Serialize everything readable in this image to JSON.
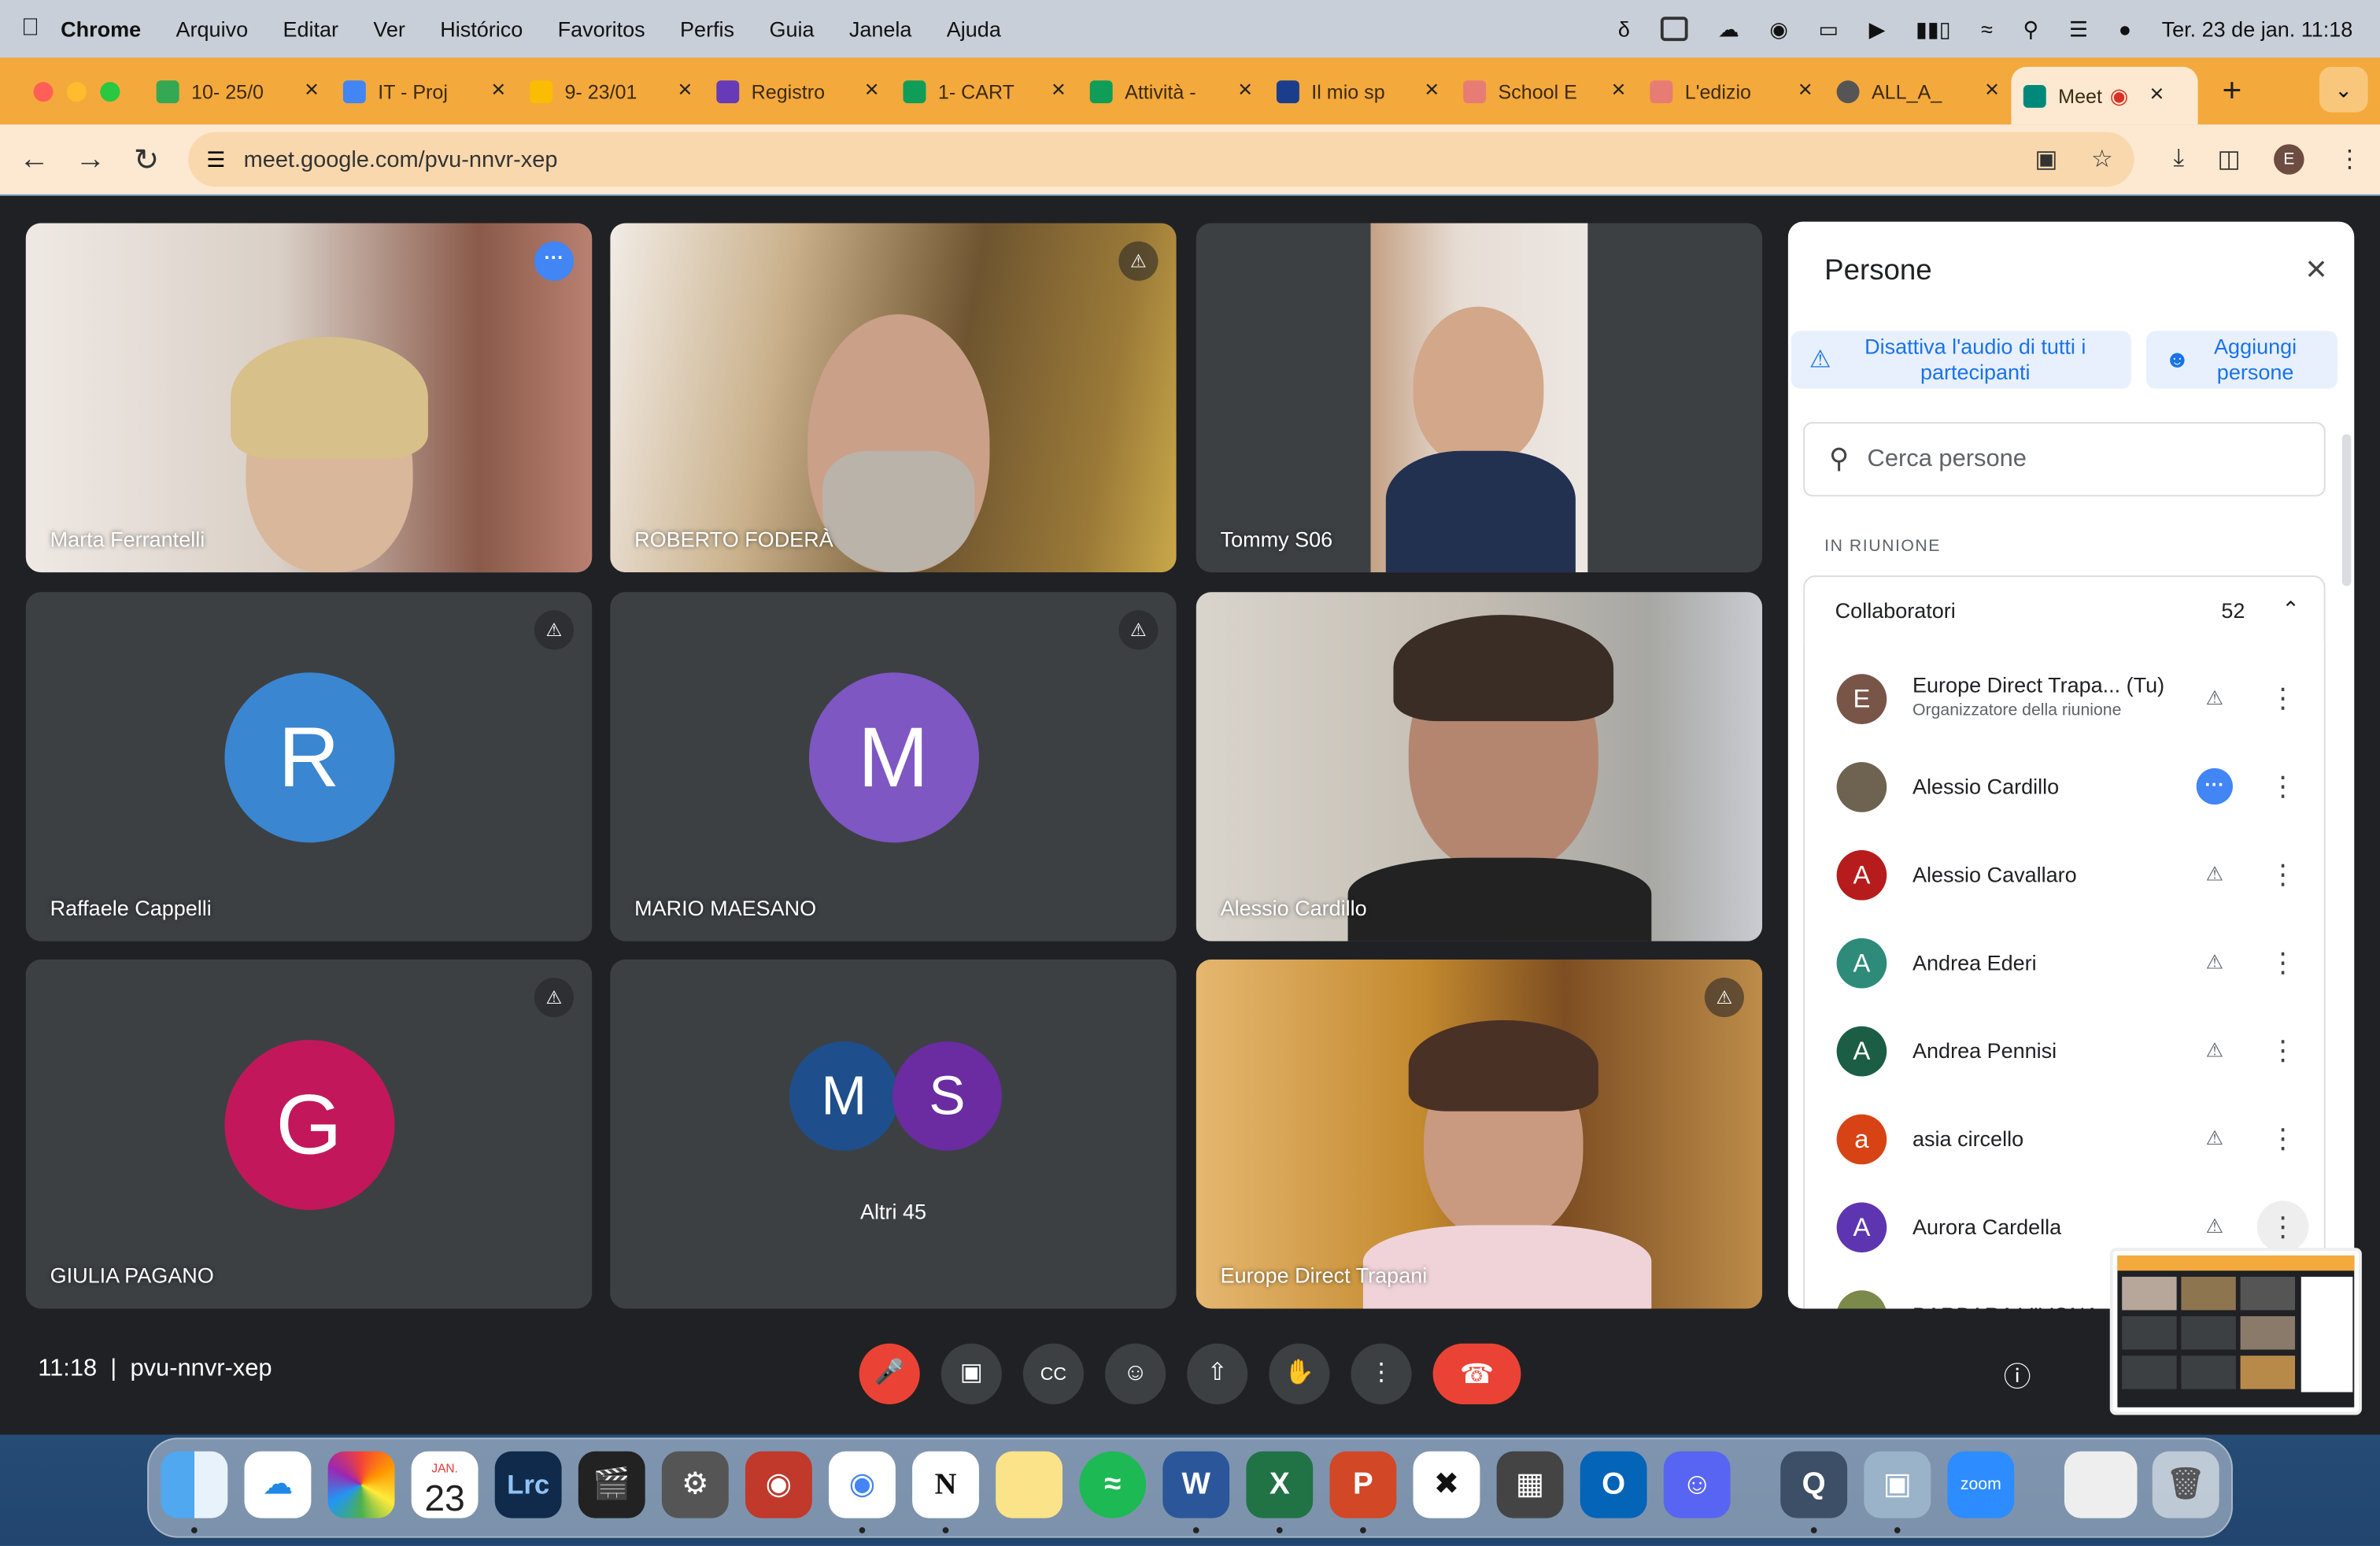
{
  "menubar": {
    "app": "Chrome",
    "items": [
      "Arquivo",
      "Editar",
      "Ver",
      "Histórico",
      "Favoritos",
      "Perfis",
      "Guia",
      "Janela",
      "Ajuda"
    ],
    "datetime": "Ter. 23 de jan.  11:18"
  },
  "tabs": [
    {
      "title": "10- 25/0",
      "color": "#34a853"
    },
    {
      "title": "IT - Proj",
      "color": "#4285f4"
    },
    {
      "title": "9- 23/01",
      "color": "#fbbc04"
    },
    {
      "title": "Registro",
      "color": "#673ab7"
    },
    {
      "title": "1- CART",
      "color": "#0f9d58"
    },
    {
      "title": "Attività -",
      "color": "#0f9d58"
    },
    {
      "title": "Il mio sp",
      "color": "#1a3e8c"
    },
    {
      "title": "School E",
      "color": "#e67c73"
    },
    {
      "title": "L'edizio",
      "color": "#e67c73"
    },
    {
      "title": "ALL_A_",
      "color": "#555555"
    },
    {
      "title": "Meet",
      "color": "#00897b"
    }
  ],
  "address": {
    "url": "meet.google.com/pvu-nnvr-xep"
  },
  "tiles": [
    {
      "name": "Marta Ferrantelli"
    },
    {
      "name": "ROBERTO FODERÀ"
    },
    {
      "name": "Tommy S06"
    },
    {
      "name": "Raffaele Cappelli",
      "initial": "R",
      "color": "#3a86d1"
    },
    {
      "name": "MARIO MAESANO",
      "initial": "M",
      "color": "#7e57c2"
    },
    {
      "name": "Alessio Cardillo"
    },
    {
      "name": "GIULIA PAGANO",
      "initial": "G",
      "color": "#c2185b"
    },
    {
      "name": "Altri 45",
      "initial": "M",
      "initial2": "S"
    },
    {
      "name": "Europe Direct Trapani"
    }
  ],
  "panel": {
    "title": "Persone",
    "mute_all": "Disattiva l'audio di tutti i partecipanti",
    "add": "Aggiungi persone",
    "search_placeholder": "Cerca persone",
    "section": "IN RIUNIONE",
    "group": "Collaboratori",
    "count": "52",
    "people": [
      {
        "name": "Europe Direct Trapa... (Tu)",
        "sub": "Organizzatore della riunione",
        "initial": "E",
        "color": "#795548"
      },
      {
        "name": "Alessio Cardillo",
        "initial": "",
        "color": "#6d6350"
      },
      {
        "name": "Alessio Cavallaro",
        "initial": "A",
        "color": "#b71c1c"
      },
      {
        "name": "Andrea Ederi",
        "initial": "A",
        "color": "#2e8b7a"
      },
      {
        "name": "Andrea Pennisi",
        "initial": "A",
        "color": "#1b5e45"
      },
      {
        "name": "asia circello",
        "initial": "a",
        "color": "#d84315"
      },
      {
        "name": "Aurora Cardella",
        "initial": "A",
        "color": "#5e35b1"
      },
      {
        "name": "BARBARA VIVONA",
        "initial": "",
        "color": "#7a8a4a"
      }
    ]
  },
  "bottom": {
    "time": "11:18",
    "code": "pvu-nnvr-xep"
  },
  "dock": {
    "calendar_month": "JAN.",
    "calendar_day": "23",
    "zoom_label": "zoom"
  }
}
